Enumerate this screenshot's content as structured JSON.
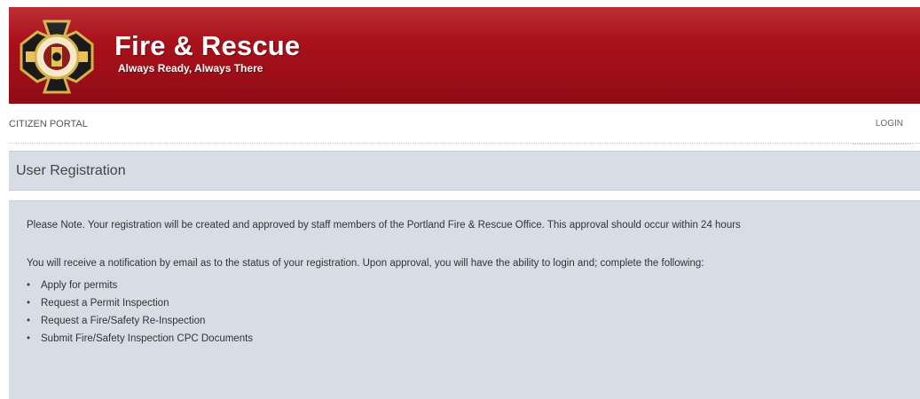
{
  "header": {
    "title": "Fire & Rescue",
    "tagline": "Always Ready, Always There",
    "logo_icon": "fire-rescue-badge-icon",
    "colors": {
      "banner": "#a3101a",
      "text": "#ffffff"
    }
  },
  "nav": {
    "brand": "CITIZEN PORTAL",
    "login": "LOGIN"
  },
  "page": {
    "title": "User Registration"
  },
  "content": {
    "note": "Please Note. Your registration will be created and approved by staff members of the Portland Fire & Rescue Office. This approval should occur within 24 hours",
    "notification": "You will receive a notification by email as to the status of your registration. Upon approval, you will have the ability to login and; complete the following:",
    "items": [
      "Apply for permits",
      "Request a Permit Inspection",
      "Request a Fire/Safety Re-Inspection",
      "Submit Fire/Safety Inspection CPC Documents"
    ],
    "panel_color": "#d6dde5"
  }
}
